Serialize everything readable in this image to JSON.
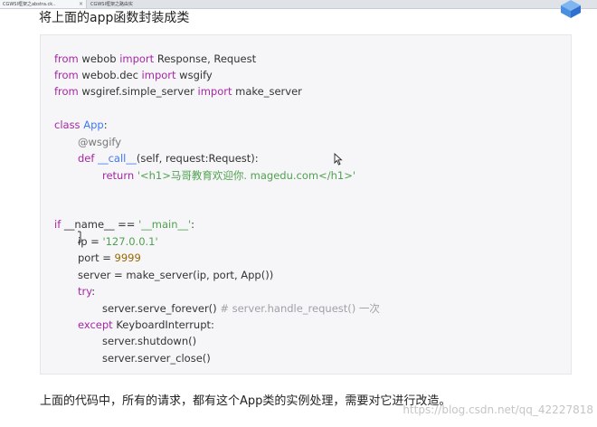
{
  "browser": {
    "tabs": [
      {
        "label": "CGWSI框架之abstra.ck..",
        "active": true
      },
      {
        "label": "CGWSI框架之路由实",
        "active": false
      }
    ]
  },
  "article": {
    "heading": "将上面的app函数封装成类",
    "code": {
      "l1": {
        "kw1": "from",
        "mod": " webob ",
        "kw2": "import",
        "rest": " Response, Request"
      },
      "l2": {
        "kw1": "from",
        "mod": " webob.dec ",
        "kw2": "import",
        "rest": " wsgify"
      },
      "l3": {
        "kw1": "from",
        "mod": " wsgiref.simple_server ",
        "kw2": "import",
        "rest": " make_server"
      },
      "l4": {
        "kw": "class",
        "name": " App",
        "rest": ":"
      },
      "l5": {
        "dec": "@wsgify"
      },
      "l6": {
        "kw": "def",
        "name": " __call__",
        "rest": "(self, request:Request):"
      },
      "l7": {
        "kw": "return",
        "str": " '<h1>马哥教育欢迎你. magedu.com</h1>'"
      },
      "l8": {
        "kw": "if",
        "rest1": " __name__ == ",
        "str": "'__main__'",
        "rest2": ":"
      },
      "l9": {
        "rest": "ip = ",
        "str": "'127.0.0.1'"
      },
      "l10": {
        "rest": "port = ",
        "num": "9999"
      },
      "l11": {
        "rest": "server = make_server(ip, port, App())"
      },
      "l12": {
        "kw": "try",
        "rest": ":"
      },
      "l13": {
        "rest": "server.serve_forever() ",
        "cmt": "# server.handle_request() 一次"
      },
      "l14": {
        "kw": "except",
        "rest": " KeyboardInterrupt:"
      },
      "l15": {
        "rest": "server.shutdown()"
      },
      "l16": {
        "rest": "server.server_close()"
      }
    },
    "footer": "上面的代码中，所有的请求，都有这个App类的实例处理，需要对它进行改造。"
  },
  "watermark": "https://blog.csdn.net/qq_42227818",
  "colors": {
    "keyword": "#a626a4",
    "class_name": "#4078f2",
    "string": "#50a14f",
    "number": "#986801",
    "comment": "#a0a1a7",
    "code_bg": "#f6f6f8"
  },
  "icons": {
    "corner": "logo-icon",
    "pointer": "mouse-cursor-icon",
    "text_cursor": "text-cursor-icon"
  }
}
